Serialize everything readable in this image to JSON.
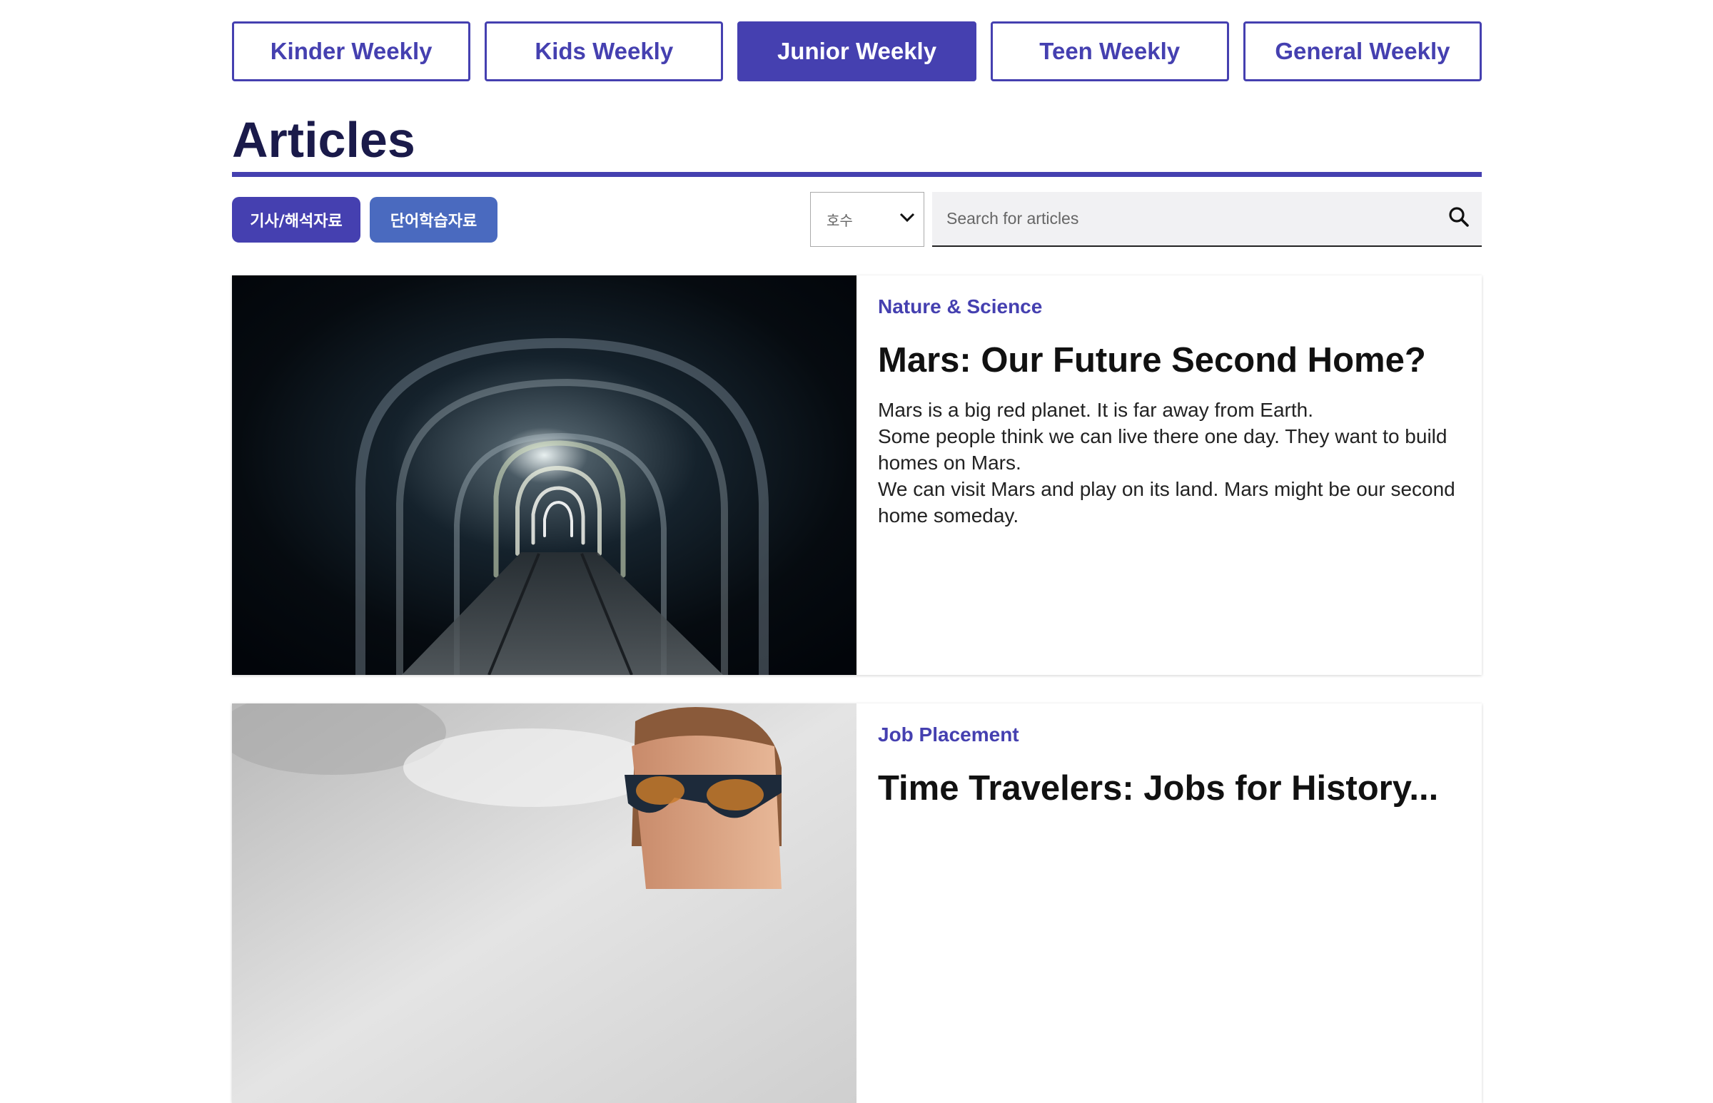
{
  "tabs": [
    {
      "label": "Kinder Weekly",
      "active": false
    },
    {
      "label": "Kids Weekly",
      "active": false
    },
    {
      "label": "Junior Weekly",
      "active": true
    },
    {
      "label": "Teen Weekly",
      "active": false
    },
    {
      "label": "General Weekly",
      "active": false
    }
  ],
  "page_title": "Articles",
  "filters": {
    "article_button": "기사/해석자료",
    "vocab_button": "단어학습자료",
    "issue_select": "호수",
    "search_placeholder": "Search for articles"
  },
  "articles": [
    {
      "category": "Nature & Science",
      "title": "Mars: Our Future Second Home?",
      "summary": [
        "Mars is a big red planet. It is far away from Earth.",
        "Some people think we can live there one day. They want to build homes on Mars.",
        "We can visit Mars and play on its land. Mars might be our second home someday."
      ],
      "image": "dark-tunnel-photo"
    },
    {
      "category": "Job Placement",
      "title": "Time Travelers: Jobs for History...",
      "image": "man-in-sunglasses-photo"
    }
  ],
  "colors": {
    "accent": "#4540b0",
    "secondary": "#4a6abf",
    "heading": "#1a1a4a"
  }
}
